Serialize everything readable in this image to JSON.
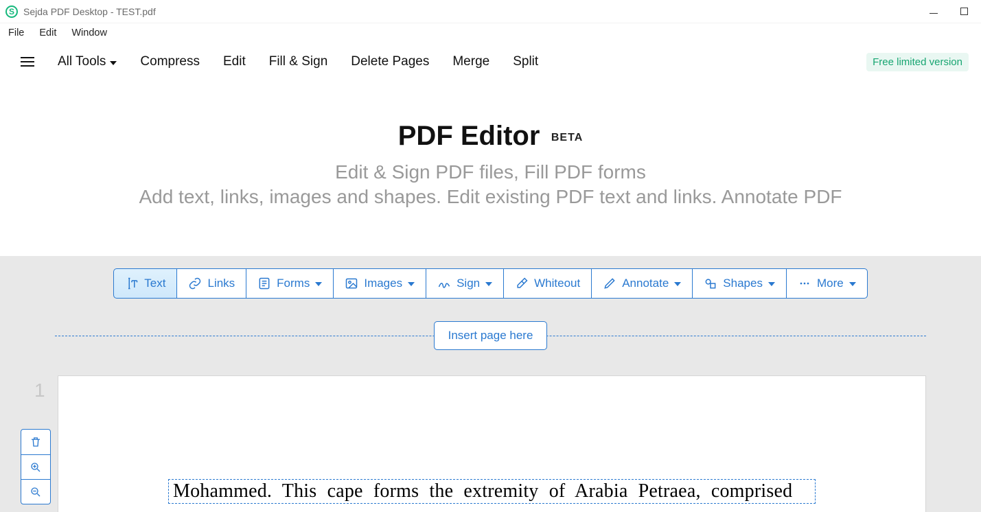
{
  "window": {
    "title": "Sejda PDF Desktop - TEST.pdf",
    "app_initial": "S"
  },
  "menubar": {
    "file": "File",
    "edit": "Edit",
    "window": "Window"
  },
  "toolbar": {
    "all_tools": "All Tools",
    "compress": "Compress",
    "edit": "Edit",
    "fill_sign": "Fill & Sign",
    "delete_pages": "Delete Pages",
    "merge": "Merge",
    "split": "Split",
    "version_badge": "Free limited version"
  },
  "hero": {
    "title": "PDF Editor",
    "badge": "BETA",
    "sub1": "Edit & Sign PDF files, Fill PDF forms",
    "sub2": "Add text, links, images and shapes. Edit existing PDF text and links. Annotate PDF"
  },
  "actions": {
    "text": "Text",
    "links": "Links",
    "forms": "Forms",
    "images": "Images",
    "sign": "Sign",
    "whiteout": "Whiteout",
    "annotate": "Annotate",
    "shapes": "Shapes",
    "more": "More"
  },
  "insert": {
    "label": "Insert page here"
  },
  "page": {
    "number": "1",
    "text": "Mohammed. This cape forms the extremity of Arabia Petraea, comprised"
  }
}
